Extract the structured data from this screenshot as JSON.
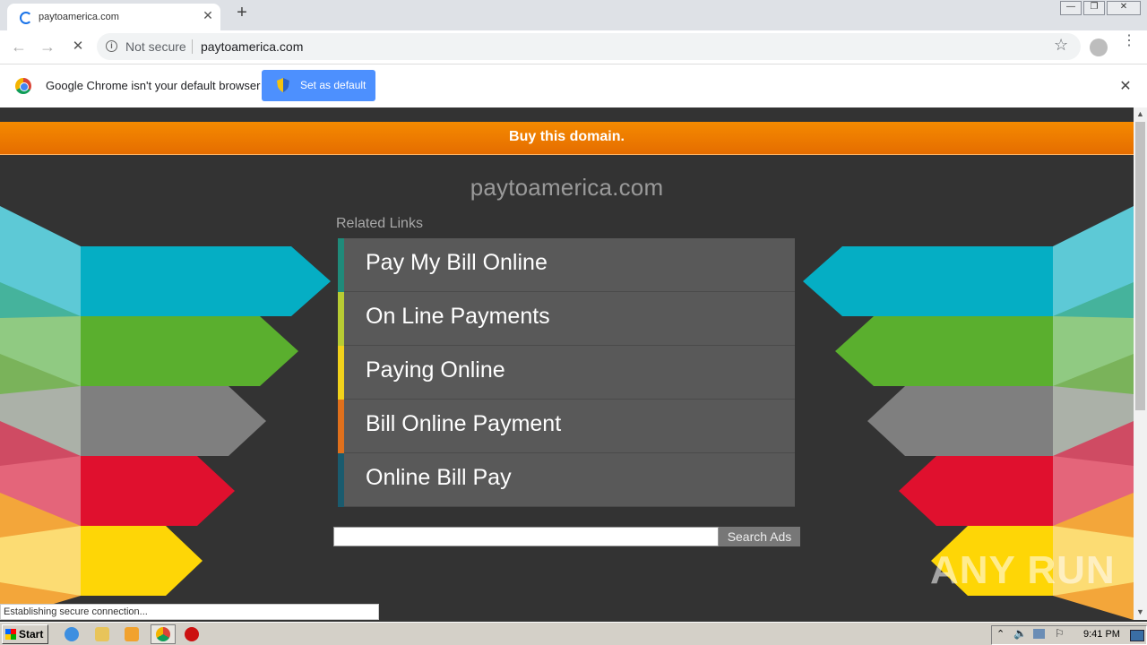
{
  "browser": {
    "tab": {
      "title": "paytoamerica.com",
      "close": "✕"
    },
    "new_tab": "+",
    "window_controls": {
      "minimize": "—",
      "restore": "❐",
      "close": "✕"
    },
    "toolbar": {
      "back": "←",
      "forward": "→",
      "reload": "✕",
      "security_label": "Not secure",
      "url": "paytoamerica.com",
      "star": "☆",
      "menu": "⋮"
    },
    "infobar": {
      "message": "Google Chrome isn't your default browser",
      "button": "Set as default",
      "close": "✕"
    },
    "status": "Establishing secure connection..."
  },
  "page": {
    "banner": "Buy this domain.",
    "site_title": "paytoamerica.com",
    "related_label": "Related Links",
    "links": [
      {
        "label": "Pay My Bill Online",
        "stripe": "#1f8a7a"
      },
      {
        "label": "On Line Payments",
        "stripe": "#b8cc33"
      },
      {
        "label": "Paying Online",
        "stripe": "#f2d21b"
      },
      {
        "label": "Bill Online Payment",
        "stripe": "#e0701c"
      },
      {
        "label": "Online Bill Pay",
        "stripe": "#1a5b6e"
      }
    ],
    "search_button": "Search Ads",
    "search_value": ""
  },
  "watermark": "ANY RUN",
  "taskbar": {
    "start": "Start",
    "clock": "9:41 PM",
    "icons": [
      "ie-icon",
      "explorer-icon",
      "media-player-icon",
      "chrome-icon",
      "opera-icon"
    ]
  },
  "colors": {
    "accent_orange": "#f07c00",
    "page_bg": "#333333",
    "link_bg": "#595959",
    "decor": [
      "#05aec4",
      "#5aaf2e",
      "#7f7f7f",
      "#e0102e",
      "#fed606"
    ]
  }
}
